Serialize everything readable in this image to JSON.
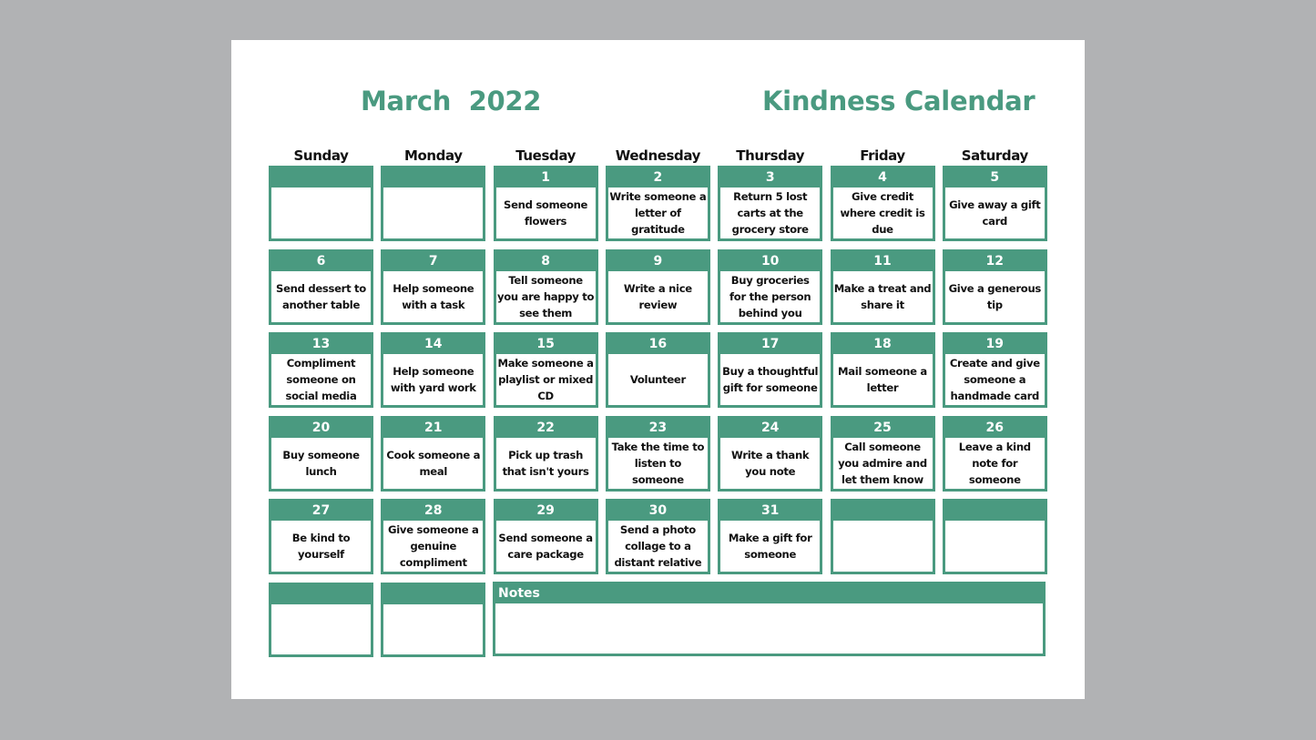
{
  "header": {
    "month_title": "March  2022",
    "calendar_title": "Kindness Calendar"
  },
  "colors": {
    "accent": "#4a9a80",
    "page_background": "#ffffff",
    "viewer_background": "#b1b2b4"
  },
  "weekdays": [
    "Sunday",
    "Monday",
    "Tuesday",
    "Wednesday",
    "Thursday",
    "Friday",
    "Saturday"
  ],
  "weeks": [
    [
      {
        "day": "",
        "text": ""
      },
      {
        "day": "",
        "text": ""
      },
      {
        "day": "1",
        "text": "Send someone flowers"
      },
      {
        "day": "2",
        "text": "Write someone a letter of gratitude"
      },
      {
        "day": "3",
        "text": "Return 5 lost carts at the grocery store"
      },
      {
        "day": "4",
        "text": "Give credit where credit is due"
      },
      {
        "day": "5",
        "text": "Give away a gift card"
      }
    ],
    [
      {
        "day": "6",
        "text": "Send dessert to another table"
      },
      {
        "day": "7",
        "text": "Help someone with a task"
      },
      {
        "day": "8",
        "text": "Tell someone you are happy to see them"
      },
      {
        "day": "9",
        "text": "Write a nice review"
      },
      {
        "day": "10",
        "text": "Buy groceries for the person behind you"
      },
      {
        "day": "11",
        "text": "Make a treat and share it"
      },
      {
        "day": "12",
        "text": "Give a generous tip"
      }
    ],
    [
      {
        "day": "13",
        "text": "Compliment someone on social media"
      },
      {
        "day": "14",
        "text": "Help someone with yard work"
      },
      {
        "day": "15",
        "text": "Make someone a playlist or mixed CD"
      },
      {
        "day": "16",
        "text": "Volunteer"
      },
      {
        "day": "17",
        "text": "Buy a thoughtful gift for someone"
      },
      {
        "day": "18",
        "text": "Mail someone a letter"
      },
      {
        "day": "19",
        "text": "Create and give someone a handmade card"
      }
    ],
    [
      {
        "day": "20",
        "text": "Buy someone lunch"
      },
      {
        "day": "21",
        "text": "Cook someone a meal"
      },
      {
        "day": "22",
        "text": "Pick up trash that isn't yours"
      },
      {
        "day": "23",
        "text": "Take the time to listen to someone"
      },
      {
        "day": "24",
        "text": "Write a thank you note"
      },
      {
        "day": "25",
        "text": "Call someone you admire and let them know"
      },
      {
        "day": "26",
        "text": "Leave a kind note for someone"
      }
    ],
    [
      {
        "day": "27",
        "text": "Be kind to yourself"
      },
      {
        "day": "28",
        "text": "Give someone a genuine compliment"
      },
      {
        "day": "29",
        "text": "Send someone a care package"
      },
      {
        "day": "30",
        "text": "Send a photo collage to a distant relative"
      },
      {
        "day": "31",
        "text": "Make a gift for someone"
      },
      {
        "day": "",
        "text": ""
      },
      {
        "day": "",
        "text": ""
      }
    ]
  ],
  "extra_row": [
    {
      "day": "",
      "text": ""
    },
    {
      "day": "",
      "text": ""
    }
  ],
  "notes": {
    "label": "Notes",
    "content": ""
  }
}
